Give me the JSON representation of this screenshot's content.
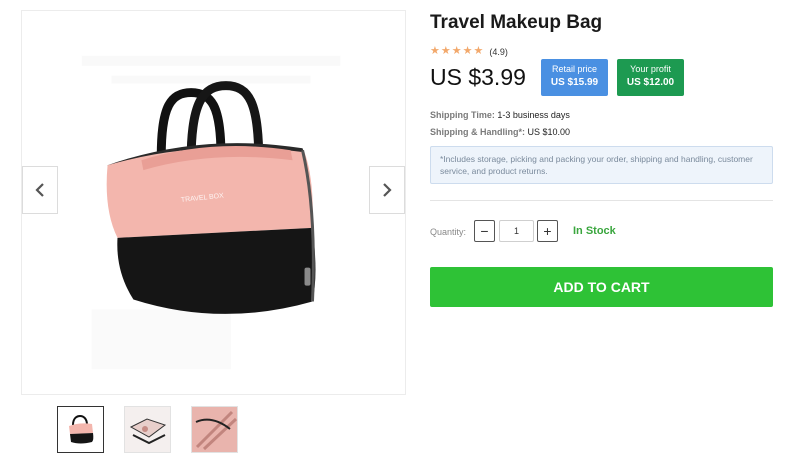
{
  "product": {
    "title": "Travel Makeup Bag",
    "bag_brand_text": "TRAVEL BOX",
    "rating_text": "(4.9)",
    "price": "US $3.99",
    "retail": {
      "label": "Retail price",
      "value": "US $15.99"
    },
    "profit": {
      "label": "Your profit",
      "value": "US $12.00"
    }
  },
  "shipping": {
    "time_label": "Shipping Time:",
    "time_value": "1-3 business days",
    "handling_label": "Shipping & Handling*:",
    "handling_value": "US $10.00",
    "note": "*Includes storage, picking and packing your order, shipping and handling, customer service, and product returns."
  },
  "purchase": {
    "quantity_label": "Quantity:",
    "quantity_value": "1",
    "minus": "−",
    "plus": "+",
    "stock_status": "In Stock",
    "add_to_cart": "ADD TO CART"
  },
  "colors": {
    "retail_badge": "#4a90e2",
    "profit_badge": "#1d9a51",
    "add_to_cart": "#2ec236",
    "in_stock": "#3aa63e",
    "stars": "#f2a86b"
  },
  "icons": {
    "prev": "chevron-left-icon",
    "next": "chevron-right-icon",
    "star": "star-icon"
  }
}
